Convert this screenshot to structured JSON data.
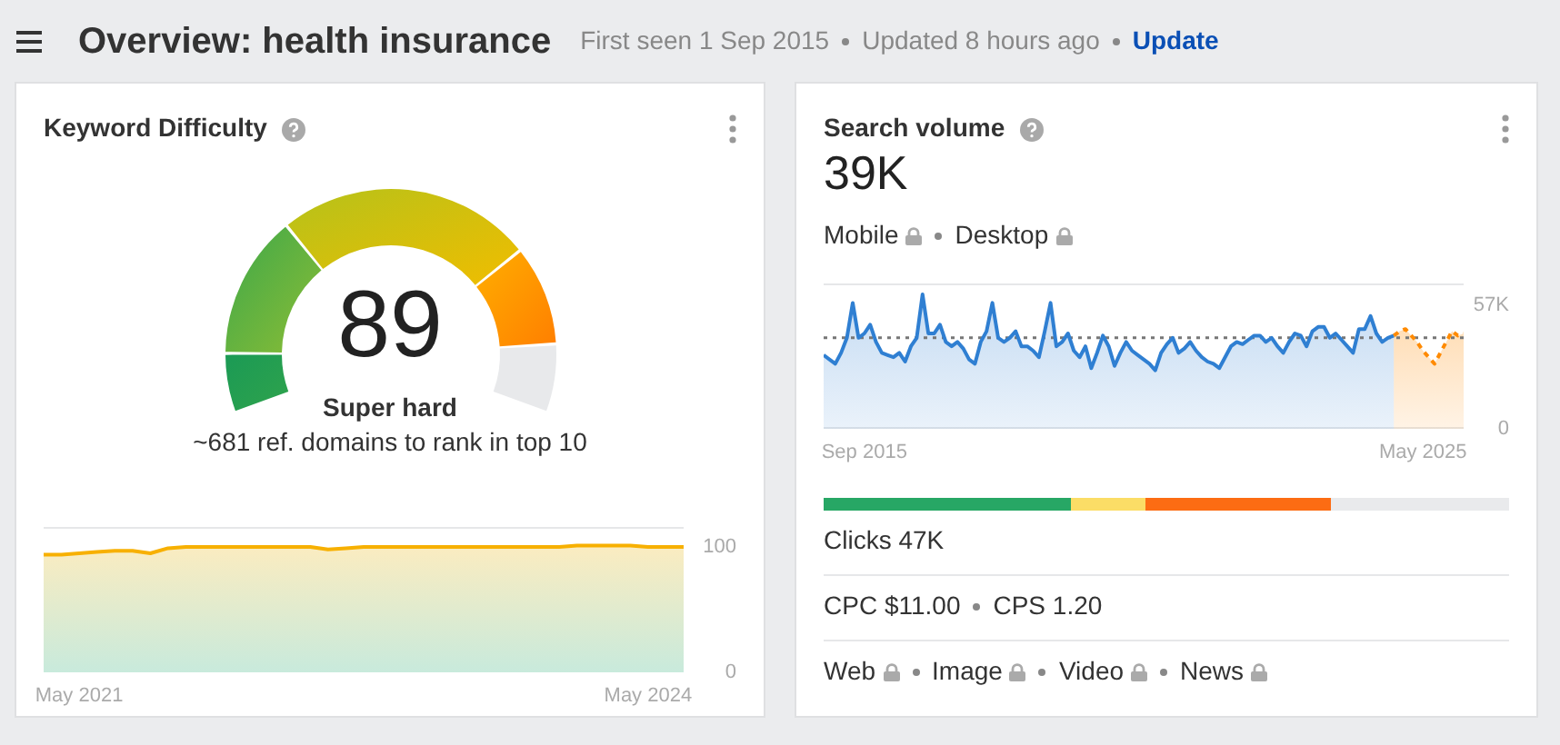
{
  "header": {
    "title": "Overview: health insurance",
    "first_seen": "First seen 1 Sep 2015",
    "updated": "Updated 8 hours ago",
    "update_link": "Update"
  },
  "keyword_difficulty": {
    "title": "Keyword Difficulty",
    "score": "89",
    "label": "Super hard",
    "note": "~681 ref. domains to rank in top 10",
    "chart_data": {
      "type": "area",
      "categories": [
        null,
        null,
        "May 2021",
        null,
        null,
        null,
        null,
        null,
        null,
        null,
        null,
        null,
        null,
        null,
        null,
        null,
        null,
        null,
        null,
        null,
        null,
        null,
        null,
        null,
        null,
        null,
        null,
        null,
        null,
        null,
        null,
        null,
        null,
        null,
        "May 2024",
        null,
        null
      ],
      "series": [
        {
          "color": "#f7b000",
          "values": [
            94,
            94,
            95,
            96,
            97,
            97,
            95,
            99,
            100,
            100,
            100,
            100,
            100,
            100,
            100,
            100,
            98,
            99,
            100,
            100,
            100,
            100,
            100,
            100,
            100,
            100,
            100,
            100,
            100,
            100,
            101,
            101,
            101,
            101,
            100,
            100,
            100
          ]
        }
      ],
      "yticks": [
        0,
        100
      ],
      "ylim": [
        0,
        116
      ]
    }
  },
  "search_volume": {
    "title": "Search volume",
    "value": "39K",
    "devices": [
      {
        "label": "Mobile",
        "locked": true
      },
      {
        "label": "Desktop",
        "locked": true
      }
    ],
    "chart_data": {
      "type": "area",
      "categories": [
        null,
        null,
        null,
        null,
        null,
        null,
        null,
        "Sep 2015",
        null,
        null,
        null,
        null,
        null,
        null,
        null,
        null,
        null,
        null,
        null,
        null,
        null,
        null,
        null,
        null,
        null,
        null,
        null,
        null,
        null,
        null,
        null,
        null,
        null,
        null,
        null,
        null,
        null,
        null,
        null,
        null,
        null,
        null,
        null,
        null,
        null,
        null,
        null,
        null,
        null,
        null,
        null,
        null,
        null,
        null,
        null,
        null,
        null,
        null,
        null,
        null,
        null,
        null,
        null,
        null,
        null,
        null,
        null,
        null,
        null,
        null,
        null,
        null,
        null,
        null,
        null,
        null,
        null,
        null,
        null,
        null,
        null,
        null,
        null,
        null,
        null,
        null,
        null,
        null,
        null,
        null,
        null,
        null,
        null,
        null,
        null,
        null,
        null,
        null,
        null,
        null,
        null,
        null,
        null,
        "May 2025",
        null,
        null,
        null,
        null,
        null,
        null,
        null
      ],
      "series": [
        {
          "color": "#2f7fd2",
          "values": [
            34,
            32,
            30,
            35,
            42,
            58,
            42,
            44,
            48,
            40,
            35,
            34,
            33,
            35,
            31,
            38,
            42,
            62,
            44,
            44,
            48,
            40,
            38,
            40,
            37,
            32,
            30,
            40,
            45,
            58,
            42,
            40,
            42,
            45,
            38,
            38,
            36,
            33,
            45,
            58,
            38,
            40,
            44,
            36,
            33,
            38,
            28,
            35,
            43,
            38,
            29,
            35,
            40,
            36,
            34,
            32,
            30,
            27,
            35,
            39,
            42,
            35,
            37,
            40,
            36,
            33,
            31,
            30,
            28,
            33,
            38,
            40,
            39,
            41,
            43,
            43,
            40,
            42,
            38,
            35,
            40,
            44,
            43,
            38,
            45,
            47,
            47,
            42,
            44,
            41,
            38,
            35,
            46,
            46,
            52,
            44,
            40,
            42,
            43,
            null,
            null,
            null,
            null,
            null,
            null,
            null,
            null,
            null,
            null,
            null,
            null
          ]
        },
        {
          "color": "#ff8a00",
          "values": [
            null,
            null,
            null,
            null,
            null,
            null,
            null,
            null,
            null,
            null,
            null,
            null,
            null,
            null,
            null,
            null,
            null,
            null,
            null,
            null,
            null,
            null,
            null,
            null,
            null,
            null,
            null,
            null,
            null,
            null,
            null,
            null,
            null,
            null,
            null,
            null,
            null,
            null,
            null,
            null,
            null,
            null,
            null,
            null,
            null,
            null,
            null,
            null,
            null,
            null,
            null,
            null,
            null,
            null,
            null,
            null,
            null,
            null,
            null,
            null,
            null,
            null,
            null,
            null,
            null,
            null,
            null,
            null,
            null,
            null,
            null,
            null,
            null,
            null,
            null,
            null,
            null,
            null,
            null,
            null,
            null,
            null,
            null,
            null,
            null,
            null,
            null,
            null,
            null,
            null,
            null,
            null,
            null,
            null,
            null,
            null,
            null,
            null,
            43,
            45,
            46,
            43,
            40,
            36,
            33,
            30,
            35,
            40,
            45,
            43,
            44
          ]
        }
      ],
      "yticks": [
        0,
        {
          "value": 57,
          "label": "57K"
        }
      ],
      "ylim": [
        0,
        67
      ],
      "ref_lines": [
        {
          "axis": "y",
          "value": 42
        }
      ]
    },
    "clicks_bar": [
      {
        "color": "#27a765"
      },
      {
        "color": "#fbdd66"
      },
      {
        "color": "#fc6c13"
      },
      {
        "color": "#e9eaec"
      }
    ],
    "clicks": "Clicks 47K",
    "cpc": "CPC $11.00",
    "cps": "CPS 1.20",
    "serp_types": [
      {
        "label": "Web",
        "locked": true
      },
      {
        "label": "Image",
        "locked": true
      },
      {
        "label": "Video",
        "locked": true
      },
      {
        "label": "News",
        "locked": true
      }
    ]
  }
}
